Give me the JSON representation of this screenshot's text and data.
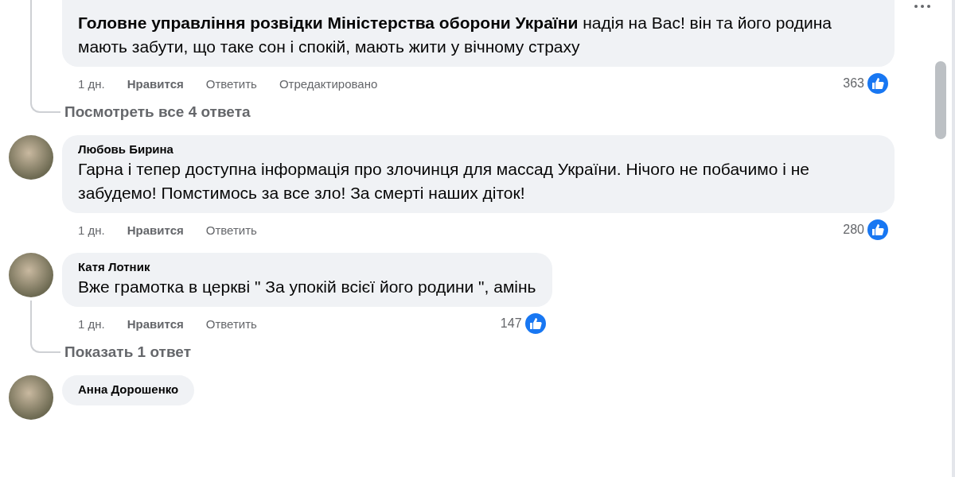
{
  "comments": [
    {
      "avatar": false,
      "text": "**Головне управління розвідки Міністерства оборони України** надія на Вас! він та його родина мають забути, що таке сон і спокій, мають жити у вічному страху",
      "time": "1 дн.",
      "like": "Нравится",
      "reply": "Ответить",
      "edited": "Отредактировано",
      "reactions": "363",
      "replies_link": "Посмотреть все 4 ответа"
    },
    {
      "avatar": true,
      "author": "Любовь Бирина",
      "text": "Гарна і тепер доступна інформація про злочинця для массад України. Нічого не побачимо і не забудемо! Помстимось за все зло! За смерті наших діток!",
      "time": "1 дн.",
      "like": "Нравится",
      "reply": "Ответить",
      "reactions": "280"
    },
    {
      "avatar": true,
      "author": "Катя Лотник",
      "text": "Вже грамотка в церкві \" За упокій всієї його родини \", амінь",
      "time": "1 дн.",
      "like": "Нравится",
      "reply": "Ответить",
      "reactions": "147",
      "replies_link": "Показать 1 ответ"
    },
    {
      "avatar": true,
      "author": "Анна Дорошенко"
    }
  ]
}
